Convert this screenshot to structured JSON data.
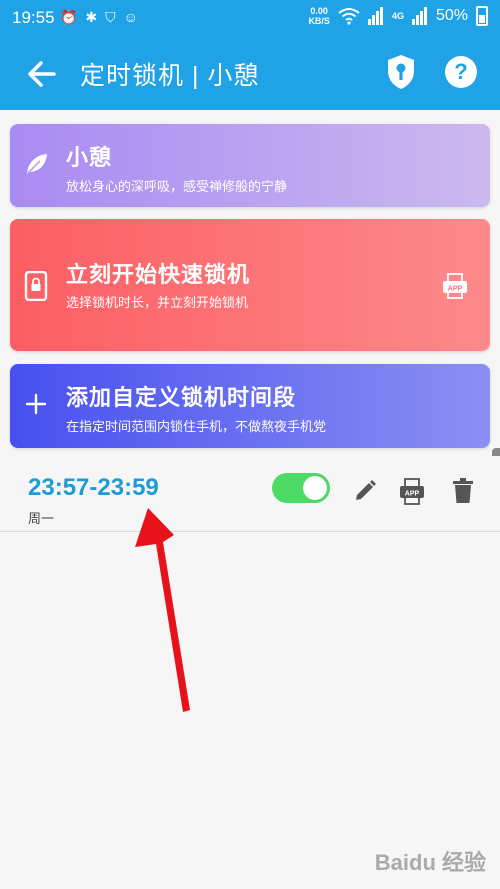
{
  "status_bar": {
    "time": "19:55",
    "net_speed_value": "0.00",
    "net_speed_unit": "KB/S",
    "signal_label": "4G",
    "battery_pct": "50%"
  },
  "app_bar": {
    "title": "定时锁机 | 小憩"
  },
  "cards": {
    "rest": {
      "title": "小憩",
      "subtitle": "放松身心的深呼吸，感受禅修般的宁静"
    },
    "quick_lock": {
      "title": "立刻开始快速锁机",
      "subtitle": "选择锁机时长，并立刻开始锁机",
      "app_badge": "APP"
    },
    "add_period": {
      "title": "添加自定义锁机时间段",
      "subtitle": "在指定时间范围内锁住手机，不做熬夜手机党"
    }
  },
  "schedules": [
    {
      "range": "23:57-23:59",
      "days": "周一",
      "enabled": true,
      "app_badge": "APP"
    }
  ],
  "watermark": "Baidu 经验",
  "colors": {
    "primary": "#1fa2e6",
    "rest_card": "#a98af3",
    "quick_card": "#fb5e63",
    "add_card": "#4750ef",
    "toggle_on": "#4cd964",
    "time_text": "#1e9bd7"
  }
}
